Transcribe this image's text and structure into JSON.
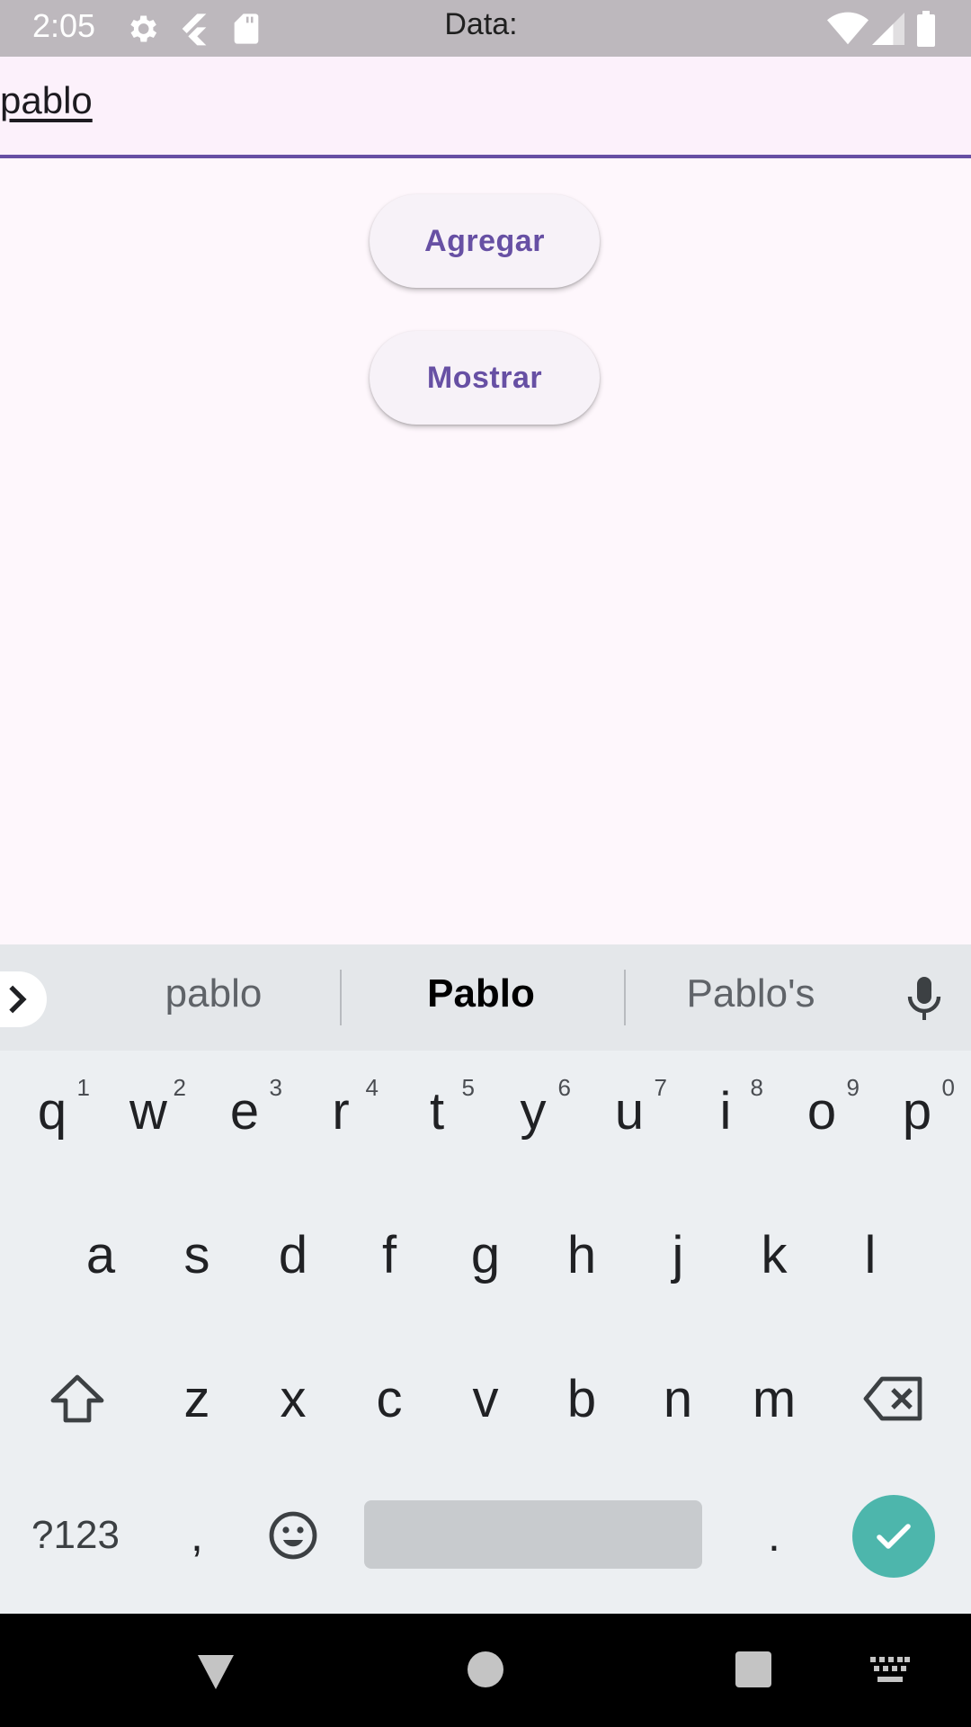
{
  "status_bar": {
    "time": "2:05",
    "title": "Data:",
    "icons": [
      "settings-icon",
      "flutter-icon",
      "sd-card-icon",
      "wifi-icon",
      "signal-icon",
      "battery-icon"
    ]
  },
  "form": {
    "input_value": "pablo",
    "accent_color": "#6750a4"
  },
  "buttons": {
    "add_label": "Agregar",
    "show_label": "Mostrar"
  },
  "keyboard": {
    "suggestions": [
      "pablo",
      "Pablo",
      "Pablo's"
    ],
    "row1": [
      {
        "key": "q",
        "hint": "1"
      },
      {
        "key": "w",
        "hint": "2"
      },
      {
        "key": "e",
        "hint": "3"
      },
      {
        "key": "r",
        "hint": "4"
      },
      {
        "key": "t",
        "hint": "5"
      },
      {
        "key": "y",
        "hint": "6"
      },
      {
        "key": "u",
        "hint": "7"
      },
      {
        "key": "i",
        "hint": "8"
      },
      {
        "key": "o",
        "hint": "9"
      },
      {
        "key": "p",
        "hint": "0"
      }
    ],
    "row2": [
      "a",
      "s",
      "d",
      "f",
      "g",
      "h",
      "j",
      "k",
      "l"
    ],
    "row3": [
      "z",
      "x",
      "c",
      "v",
      "b",
      "n",
      "m"
    ],
    "symbols_label": "?123",
    "comma": ",",
    "period": ".",
    "enter_color": "#4db6ac"
  }
}
